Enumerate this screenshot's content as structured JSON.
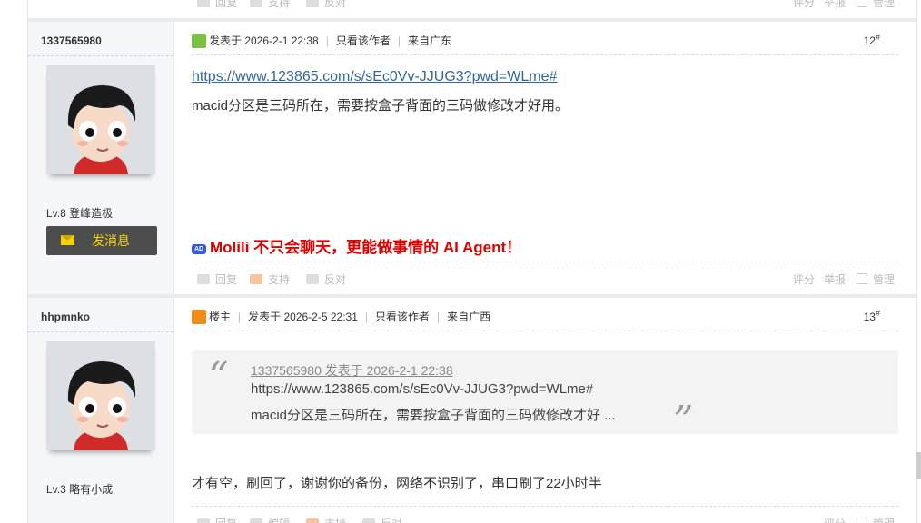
{
  "top_actions": {
    "reply": "回复",
    "support": "支持",
    "oppose": "反对",
    "rate": "评分",
    "report": "举报",
    "manage": "管理"
  },
  "post1": {
    "username": "1337565980",
    "level": "Lv.8 登峰造极",
    "send_message": "发消息",
    "meta_posted": "发表于 2026-2-1 22:38",
    "meta_only_author": "只看该作者",
    "meta_from": "来自广东",
    "floor": "12",
    "floor_sup": "#",
    "link": "https://www.123865.com/s/sEc0Vv-JJUG3?pwd=WLme#",
    "text": "macid分区是三码所在，需要按盒子背面的三码做修改才好用。",
    "ad_icon": "AD",
    "ad_text": "Molili 不只会聊天，更能做事情的 AI Agent！",
    "actions": {
      "reply": "回复",
      "support": "支持",
      "oppose": "反对",
      "rate": "评分",
      "report": "举报",
      "manage": "管理"
    }
  },
  "post2": {
    "username": "hhpmnko",
    "level": "Lv.3 略有小成",
    "owner_badge": "楼主",
    "meta_posted": "发表于 2026-2-5 22:31",
    "meta_only_author": "只看该作者",
    "meta_from": "来自广西",
    "floor": "13",
    "floor_sup": "#",
    "quote_source": "1337565980 发表于 2026-2-1 22:38",
    "quote_line1": "https://www.123865.com/s/sEc0Vv-JJUG3?pwd=WLme#",
    "quote_line2": "macid分区是三码所在，需要按盒子背面的三码做修改才好 ...",
    "text": "才有空，刷回了，谢谢你的备份，网络不识别了，串口刷了22小时半",
    "actions": {
      "reply": "回复",
      "edit": "编辑",
      "support": "支持",
      "oppose": "反对",
      "rate": "评分",
      "manage": "管理"
    }
  },
  "colors": {
    "accent_link": "#336699",
    "ad_red": "#e00000",
    "button_bg": "#4d4d4d",
    "button_text": "#f5d200"
  }
}
